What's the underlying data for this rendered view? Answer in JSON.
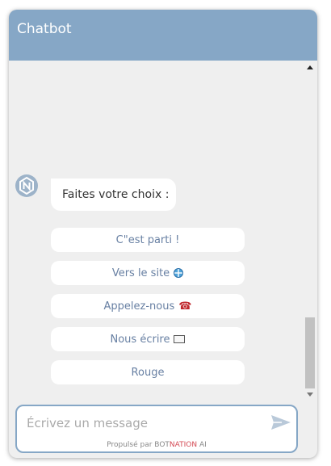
{
  "header": {
    "title": "Chatbot"
  },
  "conversation": {
    "bot_message": "Faites votre choix :",
    "choices": [
      {
        "label": "C\"est parti !",
        "icon": ""
      },
      {
        "label": "Vers le site",
        "icon": "globe-icon"
      },
      {
        "label": "Appelez-nous",
        "icon": "phone-icon"
      },
      {
        "label": "Nous écrire",
        "icon": "envelope-icon"
      },
      {
        "label": "Rouge",
        "icon": ""
      }
    ]
  },
  "input": {
    "placeholder": "Écrivez un message",
    "value": ""
  },
  "footer": {
    "powered_prefix": "Propulsé par BOT",
    "powered_brand": "NATION",
    "powered_suffix": " AI"
  },
  "colors": {
    "header_bg": "#86a7c6",
    "choice_text": "#6880a3",
    "panel_bg": "#efefef",
    "brand_accent": "#d44b55"
  }
}
